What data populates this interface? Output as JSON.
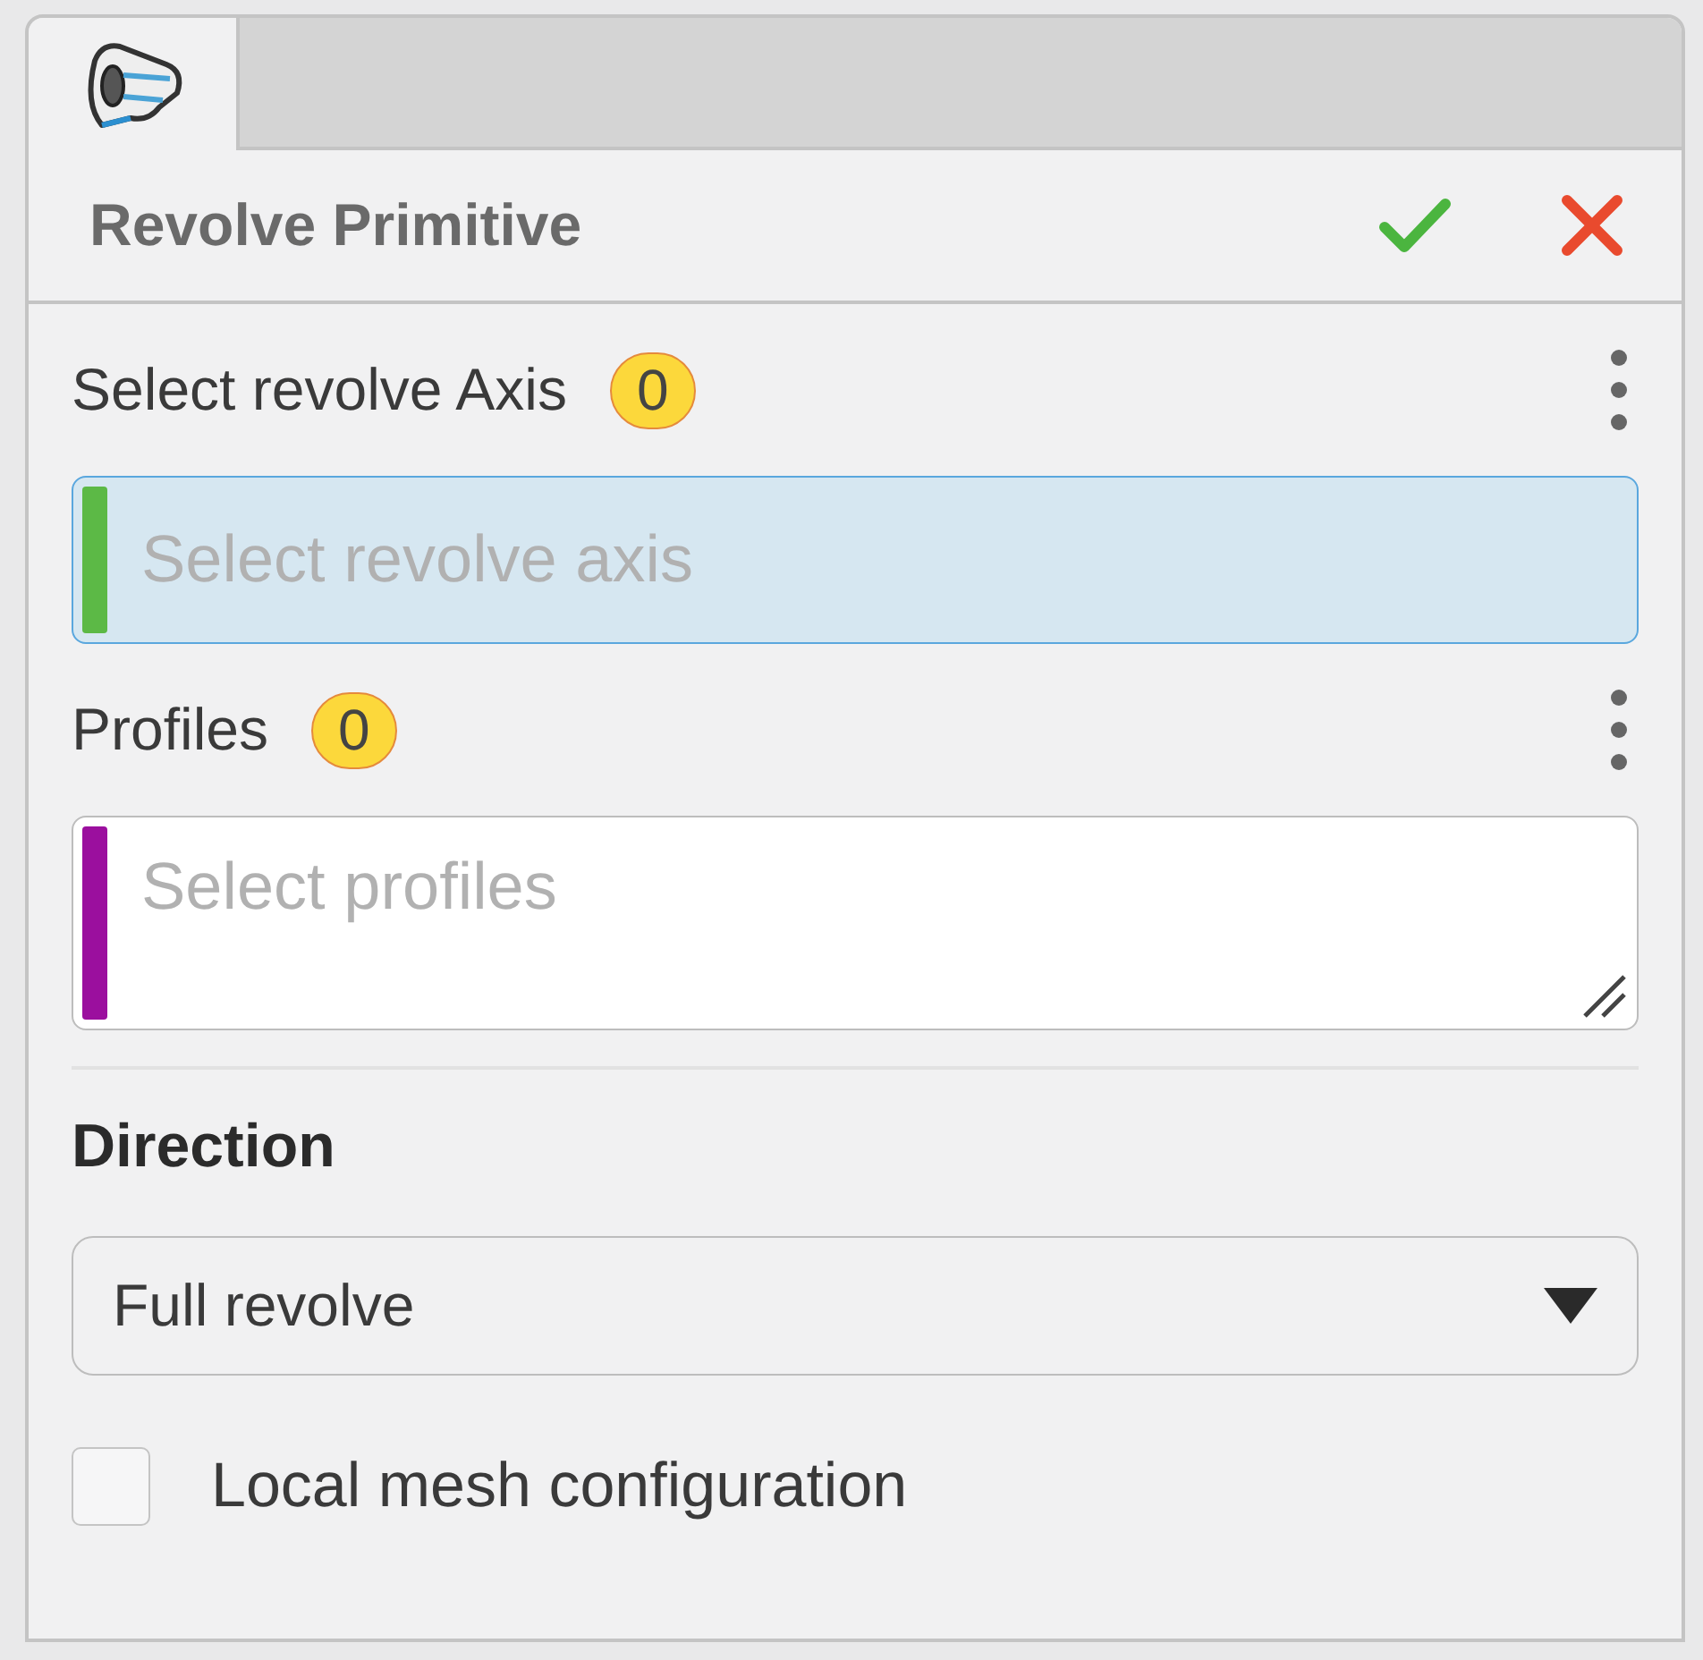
{
  "tabs": [
    {
      "kind": "revolve",
      "selected": true
    }
  ],
  "header": {
    "title": "Revolve Primitive"
  },
  "selectors": [
    {
      "label": "Select revolve Axis",
      "count": "0",
      "placeholder": "Select revolve axis",
      "color": "#5cb946",
      "active": true,
      "kind": "single"
    },
    {
      "label": "Profiles",
      "count": "0",
      "placeholder": "Select profiles",
      "color": "#9b0f9e",
      "active": false,
      "kind": "multi"
    }
  ],
  "direction": {
    "label": "Direction",
    "value": "Full revolve"
  },
  "options": [
    {
      "label": "Local mesh configuration",
      "checked": false
    }
  ]
}
